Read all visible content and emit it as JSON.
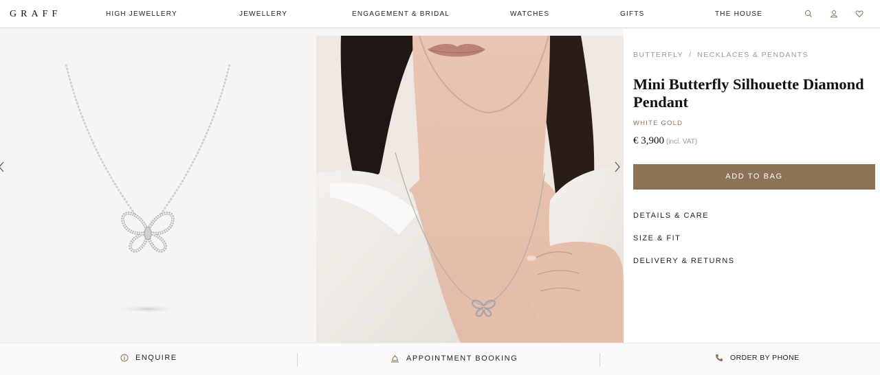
{
  "header": {
    "logo": "GRAFF",
    "nav": [
      "HIGH JEWELLERY",
      "JEWELLERY",
      "ENGAGEMENT & BRIDAL",
      "WATCHES",
      "GIFTS",
      "THE HOUSE"
    ],
    "icons": [
      "search-icon",
      "account-icon",
      "wishlist-heart-icon"
    ]
  },
  "gallery": {
    "images": [
      "product-image",
      "model-image"
    ],
    "icons": [
      "chevron-left-icon",
      "chevron-right-icon"
    ]
  },
  "product": {
    "breadcrumb": [
      "BUTTERFLY",
      "NECKLACES & PENDANTS"
    ],
    "breadcrumb_separator": "/",
    "title": "Mini Butterfly Silhouette Diamond Pendant",
    "metal": "WHITE GOLD",
    "price": "€ 3,900",
    "vat_note": "(incl. VAT)",
    "add_to_bag": "ADD TO BAG",
    "accordions": [
      "DETAILS & CARE",
      "SIZE & FIT",
      "DELIVERY & RETURNS"
    ]
  },
  "bottom_bar": {
    "enquire": "ENQUIRE",
    "appointment": "APPOINTMENT BOOKING",
    "order_by_phone": "ORDER BY PHONE"
  },
  "colors": {
    "accent": "#8c7355",
    "gallery_bg": "#f7f4f4",
    "text": "#222222",
    "muted": "#9a9a9a"
  }
}
